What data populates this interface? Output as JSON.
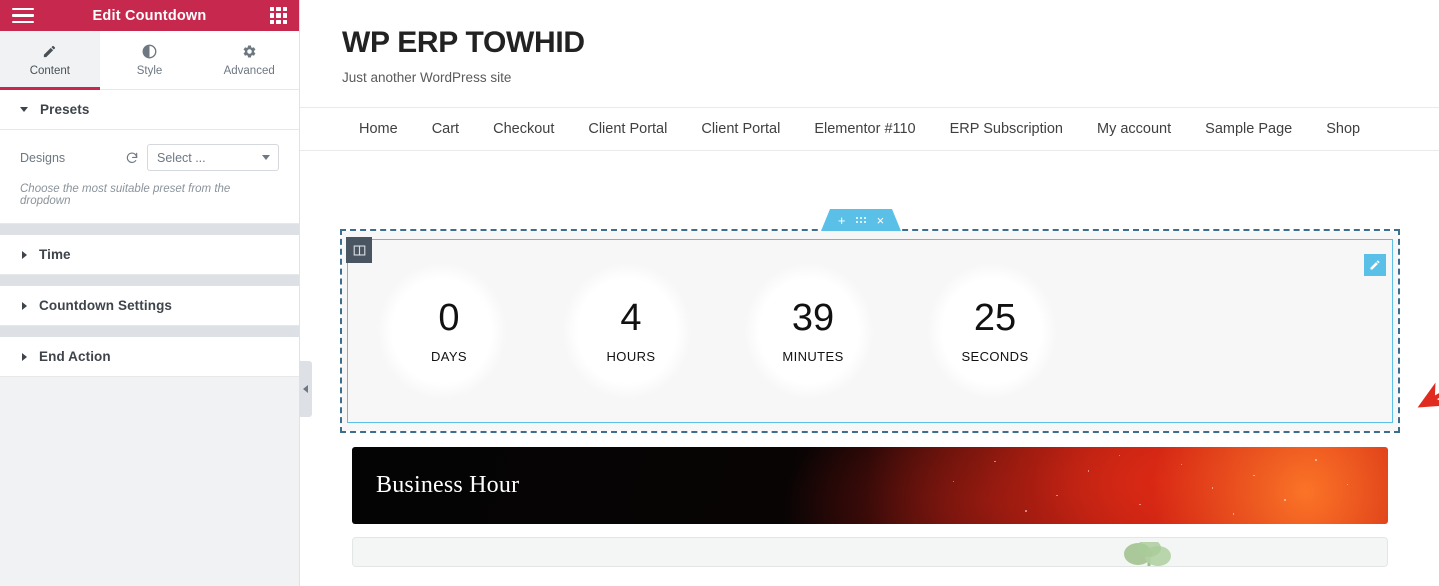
{
  "panel": {
    "title": "Edit Countdown",
    "menu_icon": "hamburger-icon",
    "apps_icon": "grid-apps-icon",
    "tabs": [
      {
        "label": "Content",
        "icon": "pencil-icon",
        "active": true
      },
      {
        "label": "Style",
        "icon": "half-circle-contrast-icon",
        "active": false
      },
      {
        "label": "Advanced",
        "icon": "gear-icon",
        "active": false
      }
    ],
    "sections": [
      {
        "title": "Presets",
        "expanded": true
      },
      {
        "title": "Time",
        "expanded": false
      },
      {
        "title": "Countdown Settings",
        "expanded": false
      },
      {
        "title": "End Action",
        "expanded": false
      }
    ],
    "presets": {
      "field_label": "Designs",
      "refresh_icon": "refresh-icon",
      "select_value": "Select ...",
      "hint": "Choose the most suitable preset from the dropdown"
    },
    "collapse_handle": "panel-collapse-arrow"
  },
  "site": {
    "title": "WP ERP TOWHID",
    "tagline": "Just another WordPress site",
    "nav": [
      "Home",
      "Cart",
      "Checkout",
      "Client Portal",
      "Client Portal",
      "Elementor #110",
      "ERP Subscription",
      "My account",
      "Sample Page",
      "Shop"
    ]
  },
  "countdown": {
    "items": [
      {
        "value": "0",
        "label": "DAYS"
      },
      {
        "value": "4",
        "label": "HOURS"
      },
      {
        "value": "39",
        "label": "MINUTES"
      },
      {
        "value": "25",
        "label": "SECONDS"
      }
    ],
    "section_toolbar": {
      "add": "+",
      "drag": "drag-dots-icon",
      "close": "×"
    },
    "column_handle_icon": "column-layout-icon",
    "widget_edit_icon": "pencil-edit-icon"
  },
  "banner": {
    "title": "Business Hour"
  },
  "colors": {
    "brand_red": "#c7284e",
    "elementor_blue": "#5bc0e8",
    "section_dashed": "#3c6e8f",
    "annotation_red": "#e02b20",
    "panel_bg": "#f1f2f3"
  },
  "annotation": {
    "arrow": "red-pointer-arrow"
  }
}
